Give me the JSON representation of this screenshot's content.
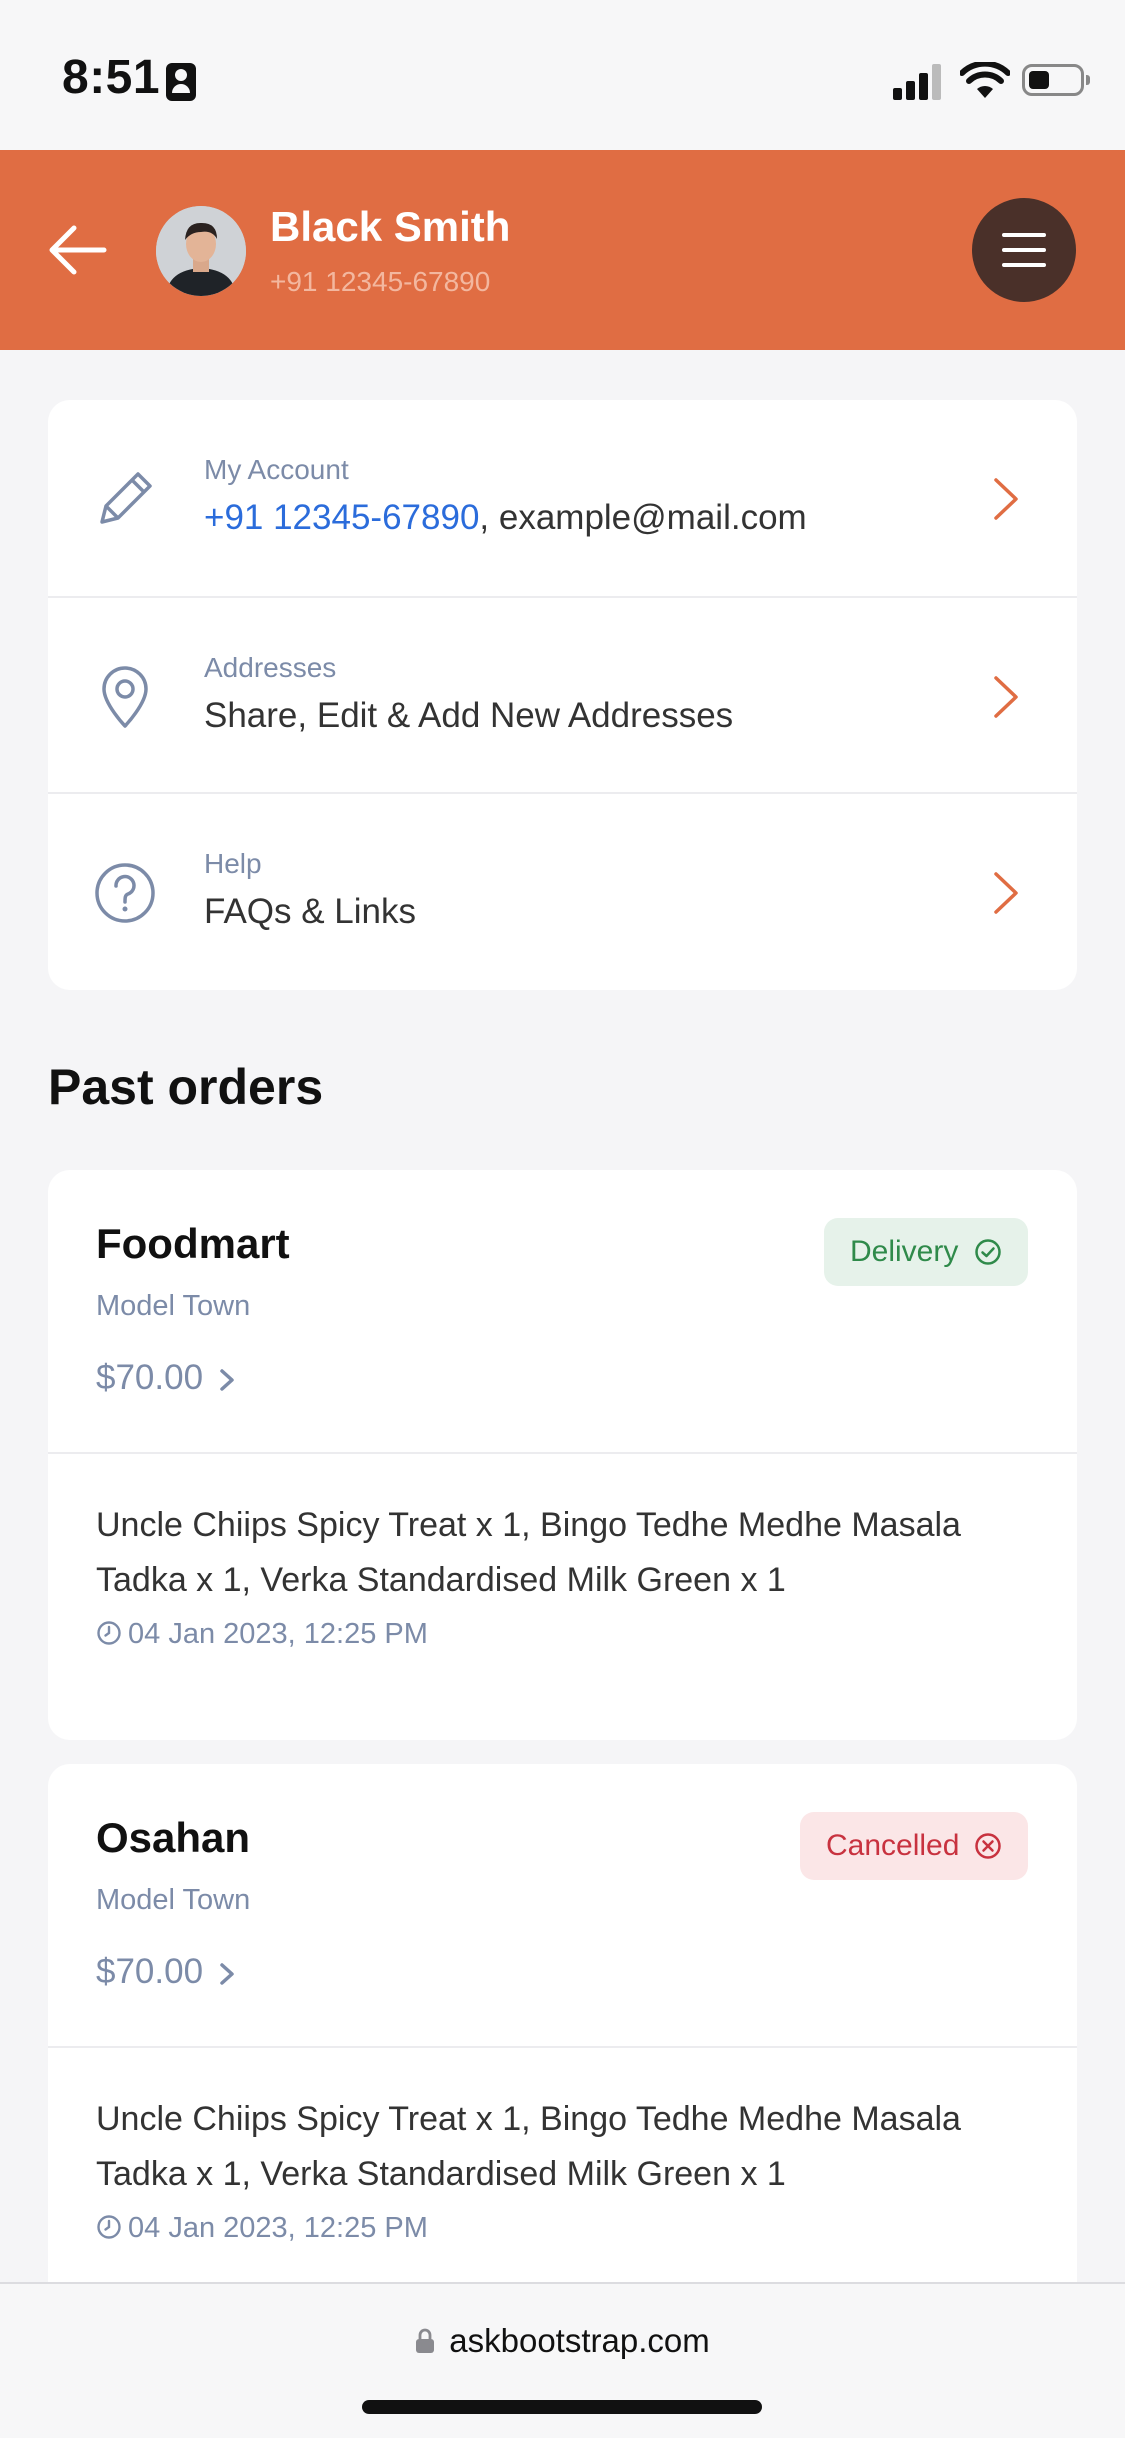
{
  "status_bar": {
    "time": "8:51"
  },
  "header": {
    "user_name": "Black Smith",
    "user_phone": "+91 12345-67890"
  },
  "account_menu": [
    {
      "label": "My Account",
      "value_link": "+91 12345-67890",
      "value_rest": ", example@mail.com",
      "icon": "pencil-icon"
    },
    {
      "label": "Addresses",
      "value": "Share, Edit & Add New Addresses",
      "icon": "location-pin-icon"
    },
    {
      "label": "Help",
      "value": "FAQs & Links",
      "icon": "help-circle-icon"
    }
  ],
  "past_orders": {
    "title": "Past orders",
    "orders": [
      {
        "store": "Foodmart",
        "location": "Model Town",
        "price": "$70.00",
        "status": "Delivery",
        "status_color": "#2f8a4a",
        "items": "Uncle Chiips Spicy Treat x 1, Bingo Tedhe Medhe Masala Tadka x 1, Verka Standardised Milk Green x 1",
        "time": "04 Jan 2023, 12:25 PM"
      },
      {
        "store": "Osahan",
        "location": "Model Town",
        "price": "$70.00",
        "status": "Cancelled",
        "status_color": "#c8323f",
        "items": "Uncle Chiips Spicy Treat x 1, Bingo Tedhe Medhe Masala Tadka x 1, Verka Standardised Milk Green x 1",
        "time": "04 Jan 2023, 12:25 PM"
      }
    ]
  },
  "browser": {
    "url": "askbootstrap.com"
  },
  "colors": {
    "accent": "#e06d43",
    "menu_button": "#4a3029",
    "link": "#2b6cdb",
    "muted": "#7c8ba8"
  }
}
